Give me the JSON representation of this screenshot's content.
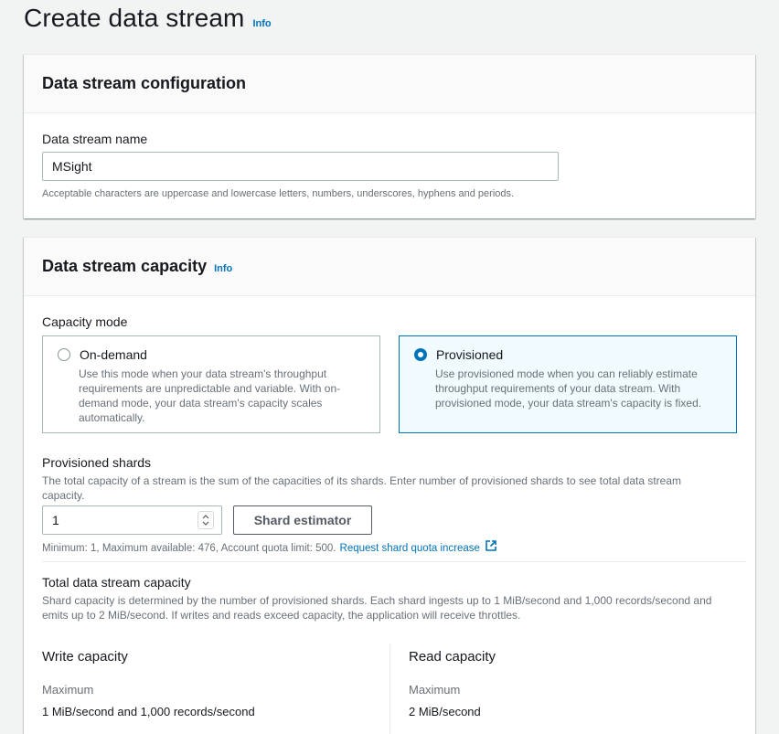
{
  "header": {
    "title": "Create data stream",
    "info_label": "Info"
  },
  "config_panel": {
    "title": "Data stream configuration",
    "name_label": "Data stream name",
    "name_value": "MSight",
    "name_hint": "Acceptable characters are uppercase and lowercase letters, numbers, underscores, hyphens and periods."
  },
  "capacity_panel": {
    "title": "Data stream capacity",
    "info_label": "Info",
    "mode_label": "Capacity mode",
    "modes": [
      {
        "label": "On-demand",
        "description": "Use this mode when your data stream's throughput requirements are unpredictable and variable. With on-demand mode, your data stream's capacity scales automatically.",
        "selected": false
      },
      {
        "label": "Provisioned",
        "description": "Use provisioned mode when you can reliably estimate throughput requirements of your data stream. With provisioned mode, your data stream's capacity is fixed.",
        "selected": true
      }
    ],
    "shards_label": "Provisioned shards",
    "shards_desc": "The total capacity of a stream is the sum of the capacities of its shards. Enter number of provisioned shards to see total data stream capacity.",
    "shards_value": "1",
    "estimator_button": "Shard estimator",
    "shards_limits": "Minimum: 1, Maximum available: 476, Account quota limit: 500.",
    "quota_link": "Request shard quota increase",
    "total_label": "Total data stream capacity",
    "total_desc": "Shard capacity is determined by the number of provisioned shards. Each shard ingests up to 1 MiB/second and 1,000 records/second and emits up to 2 MiB/second. If writes and reads exceed capacity, the application will receive throttles.",
    "write": {
      "title": "Write capacity",
      "key": "Maximum",
      "value": "1 MiB/second and 1,000 records/second"
    },
    "read": {
      "title": "Read capacity",
      "key": "Maximum",
      "value": "2 MiB/second"
    }
  },
  "colors": {
    "accent": "#0073bb",
    "background": "#f2f3f3",
    "selected_card": "#f1faff"
  }
}
